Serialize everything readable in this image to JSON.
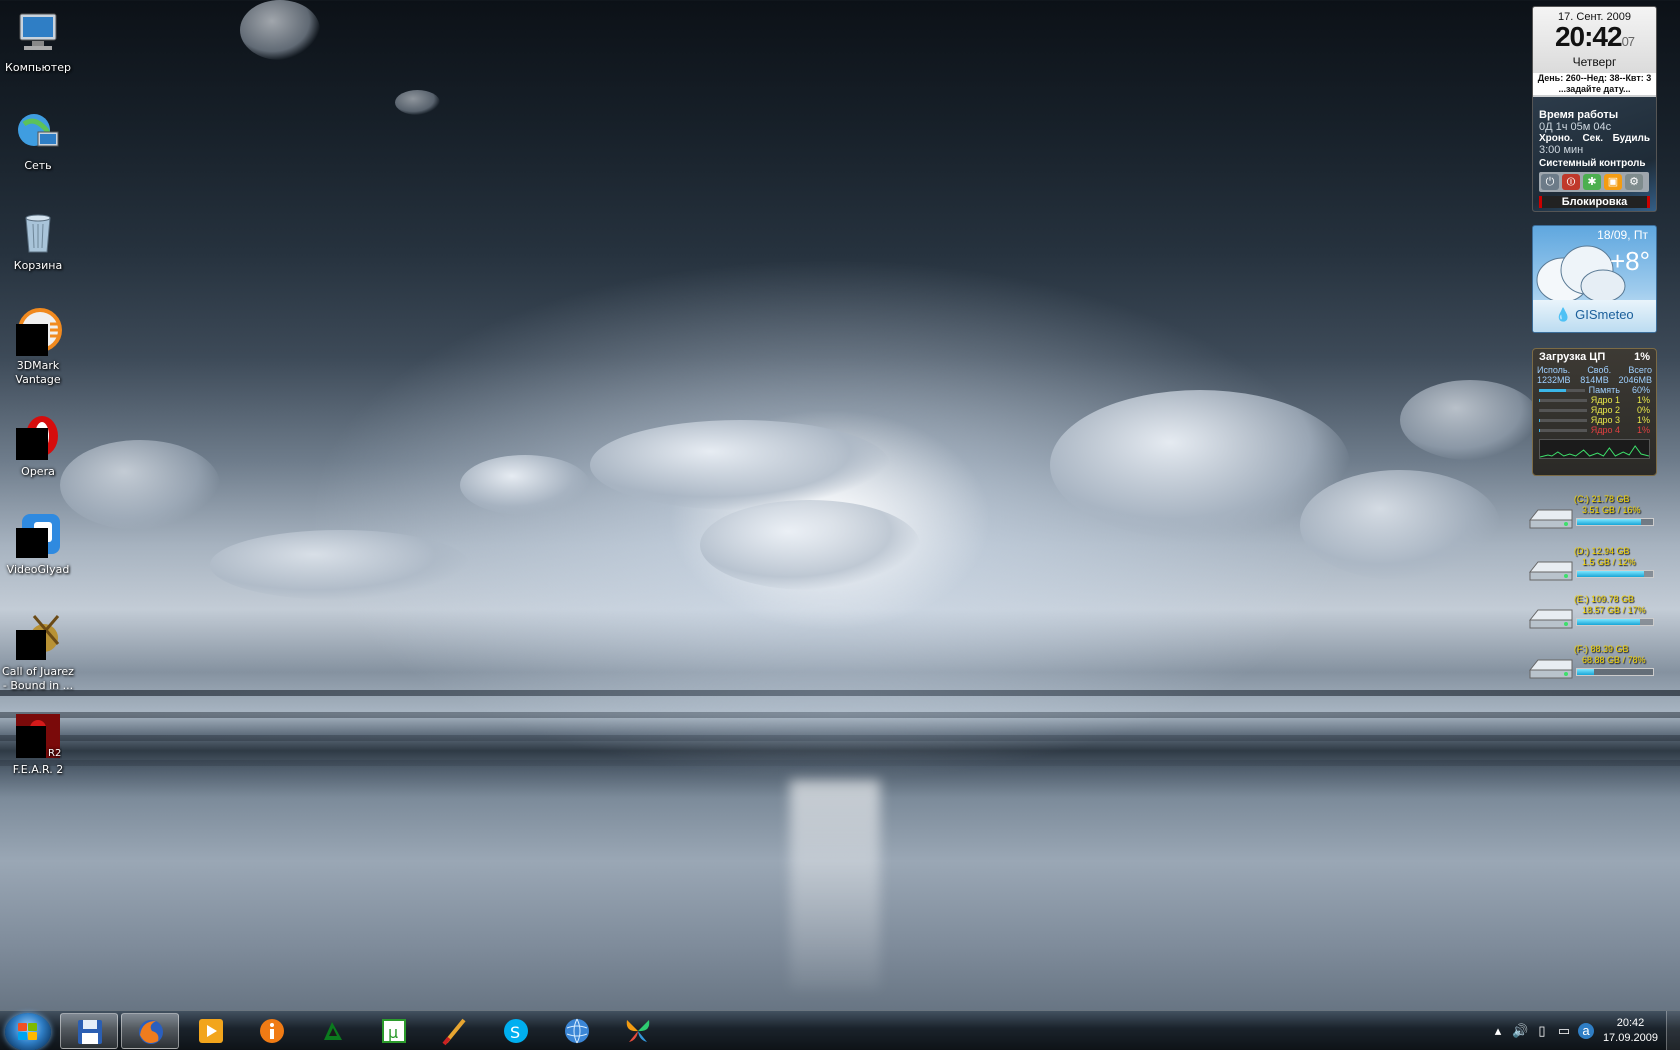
{
  "desktop": {
    "icons": [
      {
        "label": "Компьютер",
        "icon": "computer-icon"
      },
      {
        "label": "Сеть",
        "icon": "network-icon"
      },
      {
        "label": "Корзина",
        "icon": "recycle-bin-icon"
      },
      {
        "label": "3DMark Vantage",
        "icon": "3dmark-icon"
      },
      {
        "label": "Opera",
        "icon": "opera-icon"
      },
      {
        "label": "VideoGlyad",
        "icon": "videoglyad-icon"
      },
      {
        "label": "Call of Juarez - Bound in ...",
        "icon": "call-of-juarez-icon"
      },
      {
        "label": "F.E.A.R. 2",
        "icon": "fear2-icon"
      }
    ]
  },
  "clock_gadget": {
    "date": "17. Сент. 2009",
    "time": "20:42",
    "seconds": "07",
    "weekday": "Четверг",
    "day_info": "День: 260--Нед: 38--Квт: 3",
    "set_date_hint": "...задайте дату...",
    "uptime_label": "Время работы",
    "uptime_value": "0Д 1ч 05м 04с",
    "chrono_label": "Хроно.",
    "sec_label": "Сек.",
    "alarm_label": "Будиль",
    "timer_value": "3:00 мин",
    "system_control_label": "Системный контроль",
    "lock_label": "Блокировка"
  },
  "weather_gadget": {
    "date": "18/09, Пт",
    "temperature": "+8°",
    "brand": "GISmeteo"
  },
  "cpu_gadget": {
    "title": "Загрузка ЦП",
    "load": "1%",
    "mem_headers": [
      "Исполь.",
      "Своб.",
      "Всего"
    ],
    "mem_values": [
      "1232MB",
      "814MB",
      "2046MB"
    ],
    "rows": [
      {
        "label": "Память",
        "value": "60%",
        "fill": 0.6,
        "color": "#9fd0ff"
      },
      {
        "label": "Ядро 1",
        "value": "1%",
        "fill": 0.01,
        "color": "#e8e84a"
      },
      {
        "label": "Ядро 2",
        "value": "0%",
        "fill": 0.0,
        "color": "#e8e84a"
      },
      {
        "label": "Ядро 3",
        "value": "1%",
        "fill": 0.01,
        "color": "#e8e84a"
      },
      {
        "label": "Ядро 4",
        "value": "1%",
        "fill": 0.01,
        "color": "#e04040"
      }
    ]
  },
  "drives": [
    {
      "name": "(C:) 21.78 GB",
      "free": "3.51 GB / 16%",
      "fill": 0.84
    },
    {
      "name": "(D:) 12.94 GB",
      "free": "1.5 GB / 12%",
      "fill": 0.88
    },
    {
      "name": "(E:) 109.78 GB",
      "free": "18.57 GB / 17%",
      "fill": 0.83
    },
    {
      "name": "(F:) 88.39 GB",
      "free": "68.88 GB / 78%",
      "fill": 0.22
    }
  ],
  "taskbar": {
    "buttons": [
      {
        "name": "floppy-save-app",
        "icon": "floppy-icon"
      },
      {
        "name": "firefox",
        "icon": "firefox-icon"
      },
      {
        "name": "media-player",
        "icon": "media-player-icon"
      },
      {
        "name": "info-app",
        "icon": "info-icon"
      },
      {
        "name": "amd-app",
        "icon": "amd-icon"
      },
      {
        "name": "utorrent",
        "icon": "utorrent-icon"
      },
      {
        "name": "paint-app",
        "icon": "brush-icon"
      },
      {
        "name": "skype",
        "icon": "skype-icon"
      },
      {
        "name": "globe-app",
        "icon": "globe-icon"
      },
      {
        "name": "butterfly-app",
        "icon": "butterfly-icon"
      }
    ],
    "tray_time": "20:42",
    "tray_date": "17.09.2009"
  },
  "colors": {
    "accent": "#2f7ec5",
    "drive_text": "#f2d200",
    "drive_bar": "#19a5d6"
  }
}
